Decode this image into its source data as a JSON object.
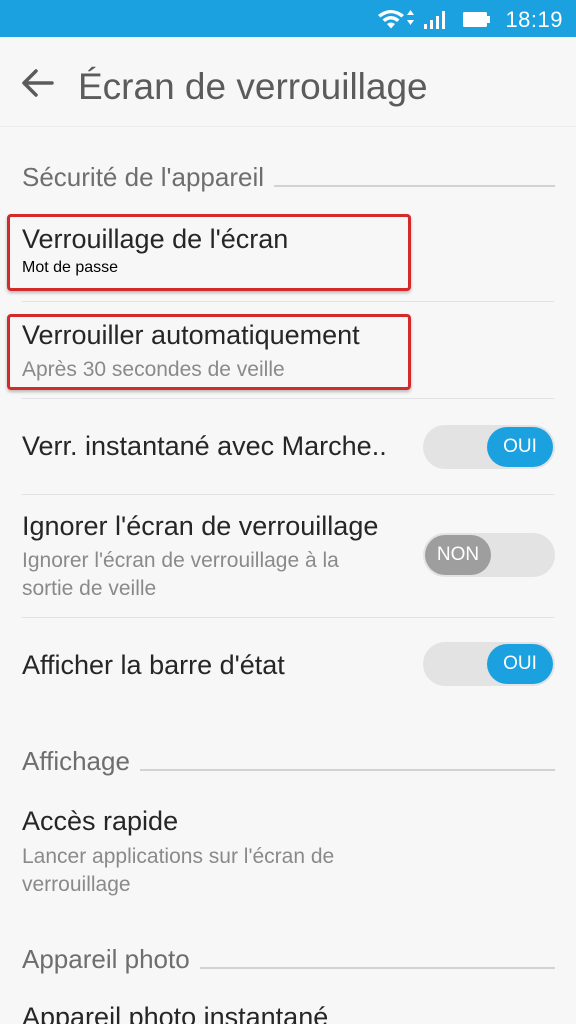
{
  "status_bar": {
    "time": "18:19",
    "icons": [
      "wifi-icon",
      "signal-icon",
      "battery-icon"
    ],
    "color": "#1ca1e0"
  },
  "app_bar": {
    "title": "Écran de verrouillage",
    "back_icon": "arrow-left-icon"
  },
  "sections": {
    "device_security": {
      "label": "Sécurité de l'appareil"
    },
    "display": {
      "label": "Affichage"
    },
    "camera": {
      "label": "Appareil photo"
    }
  },
  "settings": {
    "screen_lock": {
      "title": "Verrouillage de l'écran",
      "subtitle": "Mot de passe",
      "highlighted": true
    },
    "auto_lock": {
      "title": "Verrouiller automatiquement",
      "subtitle": "Après 30 secondes de veille",
      "highlighted": true
    },
    "instant_lock": {
      "title": "Verr. instantané avec Marche..",
      "toggle": "OUI",
      "state": true
    },
    "skip_lock": {
      "title": "Ignorer l'écran de verrouillage",
      "subtitle_1": "Ignorer l'écran de verrouillage à la",
      "subtitle_2": "sortie de veille",
      "toggle": "NON",
      "state": false
    },
    "status_bar_show": {
      "title": "Afficher la barre d'état",
      "toggle": "OUI",
      "state": true
    },
    "quick_access": {
      "title": "Accès rapide",
      "subtitle_1": "Lancer applications sur l'écran de",
      "subtitle_2": "verrouillage"
    },
    "instant_camera": {
      "title": "Appareil photo instantané"
    }
  },
  "colors": {
    "accent": "#1ca1e0",
    "highlight": "#d42a2a",
    "toggle_off": "#9e9e9e"
  }
}
